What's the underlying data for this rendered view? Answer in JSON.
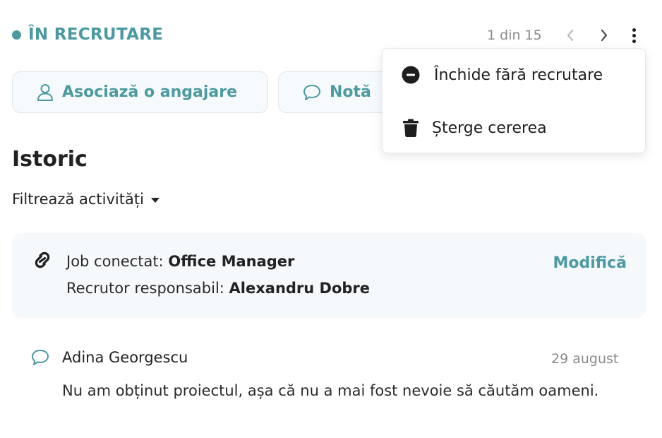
{
  "header": {
    "status_label": "ÎN RECRUTARE",
    "pager_text": "1 din 15"
  },
  "actions": {
    "associate_label": "Asociază o angajare",
    "note_label": "Notă"
  },
  "menu": {
    "close_label": "Închide fără recrutare",
    "delete_label": "Șterge cererea"
  },
  "history": {
    "title": "Istoric",
    "filter_label": "Filtrează activități",
    "job_card": {
      "job_key": "Job conectat: ",
      "job_value": "Office Manager",
      "recruiter_key": "Recrutor responsabil: ",
      "recruiter_value": "Alexandru Dobre",
      "modify_label": "Modifică"
    },
    "comment": {
      "author": "Adina Georgescu",
      "date": "29 august",
      "text": "Nu am obținut proiectul, așa că nu a mai fost nevoie să căutăm oameni."
    }
  },
  "colors": {
    "accent": "#4a9aa0",
    "muted": "#8a8a8a",
    "text": "#222222",
    "card_bg": "#f5f9fb"
  },
  "icons": {
    "status": "status-dot-icon",
    "prev": "chevron-left-icon",
    "next": "chevron-right-icon",
    "more": "more-vertical-icon",
    "associate": "user-icon",
    "note": "comment-icon",
    "close": "minus-circle-icon",
    "delete": "trash-icon",
    "job_link": "link-icon",
    "comment": "comment-icon"
  }
}
